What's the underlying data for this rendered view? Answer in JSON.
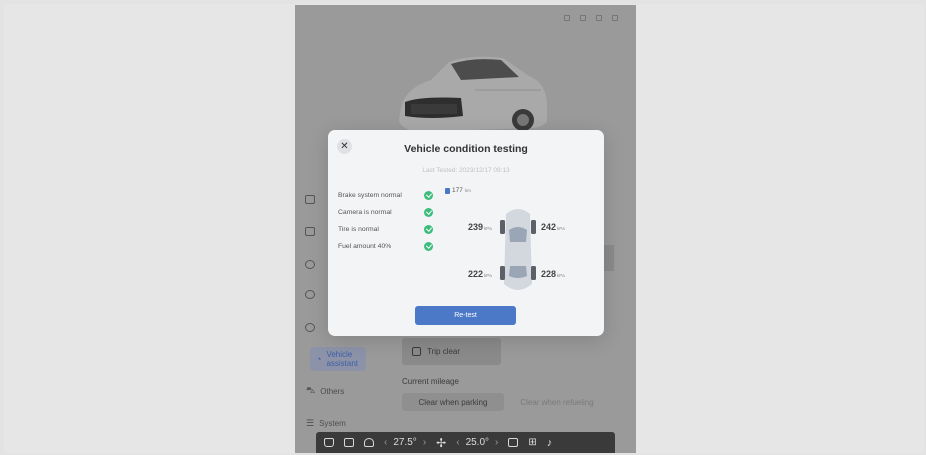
{
  "modal": {
    "close_icon": "close-icon",
    "title": "Vehicle condition testing",
    "last_tested": "Last Tested: 2023/12/17 09:13",
    "checks": [
      {
        "label": "Brake system normal",
        "status": "ok"
      },
      {
        "label": "Camera is normal",
        "status": "ok"
      },
      {
        "label": "Tire is normal",
        "status": "ok"
      },
      {
        "label": "Fuel amount 40%",
        "status": "ok"
      }
    ],
    "range": {
      "value": "177",
      "unit": "km"
    },
    "tires": {
      "front_left": {
        "value": "239",
        "unit": "kPa"
      },
      "front_right": {
        "value": "242",
        "unit": "kPa"
      },
      "rear_left": {
        "value": "222",
        "unit": "kPa"
      },
      "rear_right": {
        "value": "228",
        "unit": "kPa"
      }
    },
    "retest_label": "Re-test"
  },
  "sidebar": {
    "items": [
      {
        "label": "Vehicle assistant",
        "icon": "gauge-icon",
        "active": true
      },
      {
        "label": "Others",
        "icon": "car-icon",
        "active": false
      },
      {
        "label": "System",
        "icon": "sliders-icon",
        "active": false
      }
    ]
  },
  "content": {
    "trip_clear": "Trip clear",
    "current_mileage": "Current mileage",
    "clear_parking": "Clear when parking",
    "clear_refueling": "Clear when refueling"
  },
  "dock": {
    "left_temp": "27.5°",
    "right_temp": "25.0°"
  },
  "colors": {
    "accent": "#4b79c8",
    "ok": "#3dbd7d"
  }
}
